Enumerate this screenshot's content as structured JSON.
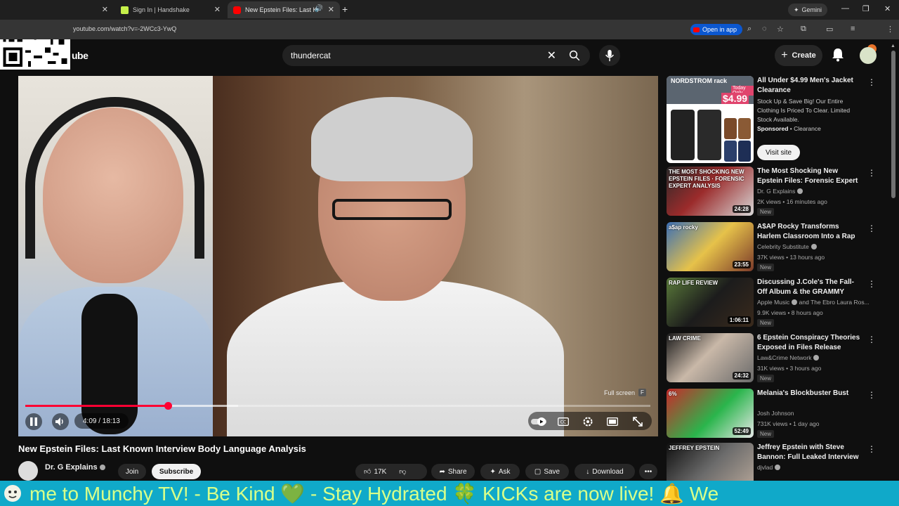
{
  "browser": {
    "tabs": [
      {
        "label": "",
        "active": false
      },
      {
        "label": "Sign In | Handshake",
        "active": false
      },
      {
        "label": "New Epstein Files: Last Know",
        "active": true
      }
    ],
    "url": "youtube.com/watch?v=-2WCc3-YwQ",
    "open_in_app": "Open in app",
    "gemini": "Gemini"
  },
  "header": {
    "logo_text": "ube",
    "search_query": "thundercat",
    "create_label": "Create"
  },
  "player": {
    "fullscreen_tip": "Full screen",
    "fullscreen_key": "F",
    "time": "4:09 / 18:13",
    "progress_fraction": 0.228,
    "buffer_fraction": 0.34
  },
  "video": {
    "title": "New Epstein Files: Last Known Interview Body Language Analysis",
    "channel": "Dr. G Explains",
    "join_label": "Join",
    "subscribe_label": "Subscribe",
    "likes": "17K",
    "share_label": "Share",
    "ask_label": "Ask",
    "save_label": "Save",
    "download_label": "Download"
  },
  "ad": {
    "title": "All Under $4.99 Men's Jacket Clearance",
    "description": "Stock Up & Save Big! Our Entire Clothing Is Priced To Clear. Limited Stock Available.",
    "sponsored": "Sponsored",
    "advertiser": "Clearance",
    "visit_label": "Visit site",
    "image_brand": "NORDSTROM rack",
    "image_price": "$4.99",
    "image_tag": "Today Only"
  },
  "recommendations": [
    {
      "title": "The Most Shocking New Epstein Files: Forensic Expert ...",
      "channel": "Dr. G Explains",
      "verified": true,
      "meta": "2K views • 16 minutes ago",
      "badge": "New",
      "duration": "24:28",
      "thumb_text": "THE MOST SHOCKING NEW EPSTEIN FILES · FORENSIC EXPERT ANALYSIS"
    },
    {
      "title": "A$AP Rocky Transforms Harlem Classroom Into a Rap Video ...",
      "channel": "Celebrity Substitute",
      "verified": true,
      "meta": "37K views • 13 hours ago",
      "badge": "New",
      "duration": "23:55",
      "thumb_text": "a$ap rocky"
    },
    {
      "title": "Discussing J.Cole's The Fall-Off Album & the GRAMMY Awards...",
      "channel": "Apple Music",
      "verified": true,
      "channel_extra": "and The Ebro Laura Ros...",
      "meta": "9.9K views • 8 hours ago",
      "badge": "New",
      "duration": "1:06:11",
      "thumb_text": "RAP LIFE REVIEW"
    },
    {
      "title": "6 Epstein Conspiracy Theories Exposed in Files Release",
      "channel": "Law&Crime Network",
      "verified": true,
      "meta": "31K views • 3 hours ago",
      "badge": "New",
      "duration": "24:32",
      "thumb_text": "LAW CRIME"
    },
    {
      "title": "Melania's Blockbuster Bust",
      "channel": "Josh Johnson",
      "verified": false,
      "meta": "731K views • 1 day ago",
      "badge": "New",
      "duration": "52:49",
      "thumb_text": "6%"
    },
    {
      "title": "Jeffrey Epstein with Steve Bannon: Full Leaked Interview",
      "channel": "djvlad",
      "verified": true,
      "meta": "",
      "badge": "",
      "duration": "",
      "thumb_text": "JEFFREY EPSTEIN"
    }
  ],
  "ticker": {
    "text": "me to Munchy TV!  - Be Kind  💚  - Stay Hydrated  🍀  KICKs are now live!  🔔      We"
  },
  "colors": {
    "accent_red": "#ff0033",
    "ticker_bg": "#10a9c9",
    "ticker_text": "#d8ff8a",
    "page_bg": "#0f0f0f"
  }
}
